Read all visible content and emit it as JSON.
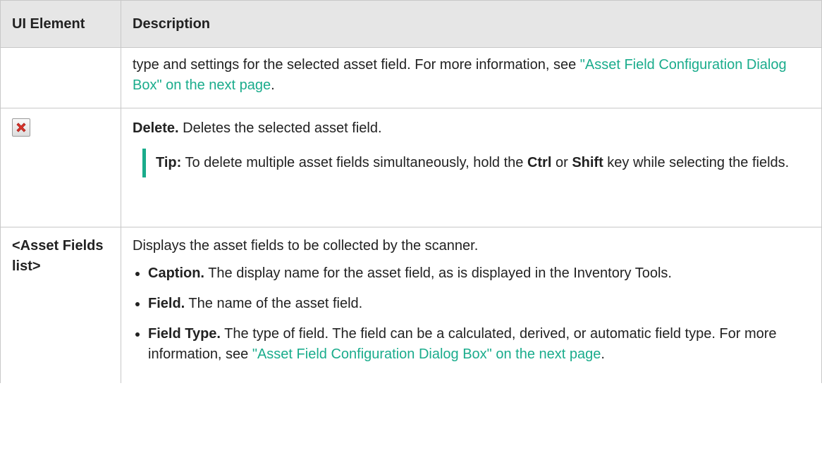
{
  "header": {
    "col1": "UI Element",
    "col2": "Description"
  },
  "row1": {
    "text_pre": "type and settings for the selected asset field. For more information, see ",
    "link": "\"Asset Field Configuration Dialog Box\" on the next page",
    "text_post": "."
  },
  "row2": {
    "icon": "delete-x-icon",
    "title": "Delete.",
    "desc": " Deletes the selected asset field.",
    "tip": {
      "label": "Tip:",
      "pre": "  To delete multiple asset fields simultaneously, hold the ",
      "key1": "Ctrl",
      "mid": " or ",
      "key2": "Shift",
      "post": " key while selecting the fields."
    }
  },
  "row3": {
    "element": "<Asset Fields list>",
    "intro": "Displays the asset fields to be collected by the scanner.",
    "items": [
      {
        "term": "Caption.",
        "desc": " The display name for the asset field, as is displayed in the Inventory Tools."
      },
      {
        "term": "Field.",
        "desc": " The name of the asset field."
      },
      {
        "term": "Field Type.",
        "desc": " The type of field. The field can be a calculated, derived, or automatic field type. For more information, see ",
        "link": "\"Asset Field Configuration Dialog Box\" on the next page",
        "post": "."
      }
    ]
  },
  "colors": {
    "link": "#1aac8c",
    "header_bg": "#e6e6e6",
    "border": "#c8c8c8",
    "icon_red": "#d9342b"
  }
}
